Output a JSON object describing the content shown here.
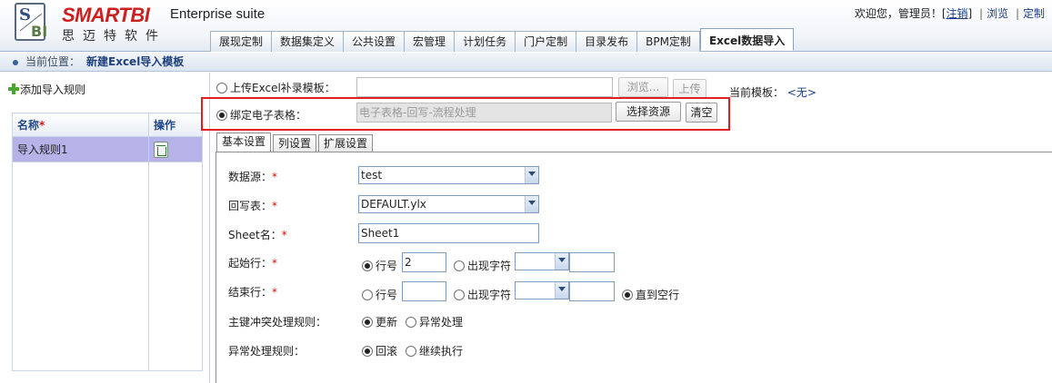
{
  "app": {
    "brand_name": "SMARTBI",
    "brand_cn": "思迈特软件",
    "logo_letters_top": "S",
    "logo_letters_bottom": "BI",
    "suite_title": "Enterprise suite"
  },
  "user_bar": {
    "greeting": "欢迎您，管理员！[",
    "logout": "注销",
    "bracket_close": "]",
    "separator": "|",
    "browse": "浏览",
    "customize": "定制"
  },
  "nav_tabs": [
    {
      "label": "展现定制",
      "active": false
    },
    {
      "label": "数据集定义",
      "active": false
    },
    {
      "label": "公共设置",
      "active": false
    },
    {
      "label": "宏管理",
      "active": false
    },
    {
      "label": "计划任务",
      "active": false
    },
    {
      "label": "门户定制",
      "active": false
    },
    {
      "label": "目录发布",
      "active": false
    },
    {
      "label": "BPM定制",
      "active": false
    },
    {
      "label": "Excel数据导入",
      "active": true
    }
  ],
  "location": {
    "label": "当前位置：",
    "value": "新建Excel导入模板"
  },
  "left_panel": {
    "add_rule": "添加导入规则",
    "col_name": "名称",
    "col_name_required": "*",
    "col_action": "操作",
    "rules": [
      {
        "name": "导入规则1",
        "action_icon": "trash-icon"
      }
    ]
  },
  "template": {
    "upload_label": "上传Excel补录模板：",
    "browse_btn": "浏览...",
    "upload_btn": "上传",
    "current_label": "当前模板：",
    "current_value": "<无>",
    "bind_label": "绑定电子表格：",
    "bind_value": "电子表格-回写-流程处理",
    "select_resource_btn": "选择资源",
    "clear_btn": "清空",
    "selected_option": "bind"
  },
  "sub_tabs": [
    {
      "label": "基本设置",
      "active": true
    },
    {
      "label": "列设置",
      "active": false
    },
    {
      "label": "扩展设置",
      "active": false
    }
  ],
  "form": {
    "datasource_label": "数据源：",
    "datasource_value": "test",
    "writeback_label": "回写表：",
    "writeback_value": "DEFAULT.ylx",
    "sheet_label": "Sheet名：",
    "sheet_value": "Sheet1",
    "required_mark": "*",
    "start_row_label": "起始行：",
    "start_opt_row": "行号",
    "start_row_value": "2",
    "start_opt_char": "出现字符",
    "end_row_label": "结束行：",
    "end_opt_row": "行号",
    "end_opt_char": "出现字符",
    "end_opt_empty": "直到空行",
    "conflict_label": "主键冲突处理规则：",
    "conflict_opt_update": "更新",
    "conflict_opt_error": "异常处理",
    "error_label": "异常处理规则：",
    "error_opt_rollback": "回滚",
    "error_opt_continue": "继续执行"
  }
}
